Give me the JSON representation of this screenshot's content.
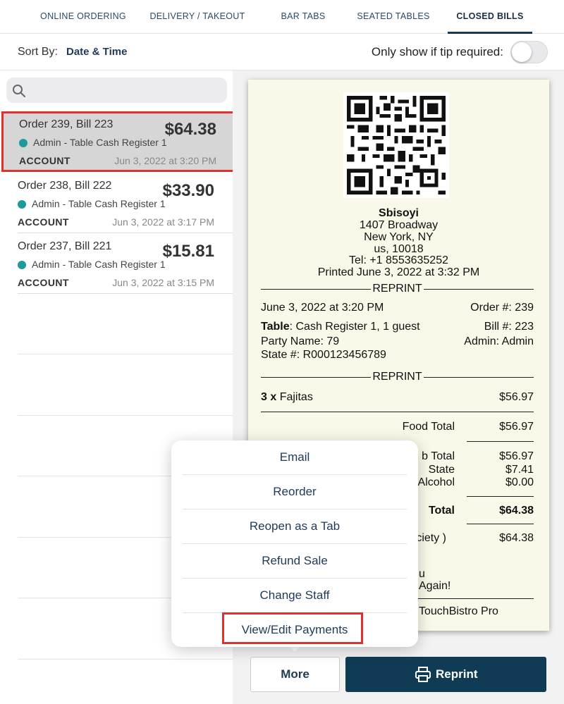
{
  "tabs": [
    {
      "label": "ONLINE ORDERING"
    },
    {
      "label": "DELIVERY / TAKEOUT"
    },
    {
      "label": "BAR TABS"
    },
    {
      "label": "SEATED TABLES"
    },
    {
      "label": "CLOSED BILLS"
    }
  ],
  "sort": {
    "label": "Sort By:",
    "value": "Date & Time"
  },
  "tip_filter": {
    "label": "Only show if tip required:"
  },
  "search": {
    "placeholder": ""
  },
  "bills": [
    {
      "title": "Order 239, Bill 223",
      "amount": "$64.38",
      "staff": "Admin - Table Cash Register 1",
      "account": "ACCOUNT",
      "time": "Jun 3, 2022 at 3:20 PM"
    },
    {
      "title": "Order 238, Bill 222",
      "amount": "$33.90",
      "staff": "Admin - Table Cash Register 1",
      "account": "ACCOUNT",
      "time": "Jun 3, 2022 at 3:17 PM"
    },
    {
      "title": "Order 237, Bill 221",
      "amount": "$15.81",
      "staff": "Admin - Table Cash Register 1",
      "account": "ACCOUNT",
      "time": "Jun 3, 2022 at 3:15 PM"
    }
  ],
  "receipt": {
    "name": "Sbisoyi",
    "address1": "1407 Broadway",
    "address2": "New York, NY",
    "address3": "us, 10018",
    "tel": "Tel: +1 8553635252",
    "printed": "Printed June 3, 2022 at 3:32 PM",
    "reprint": "REPRINT",
    "date": "June 3, 2022 at 3:20 PM",
    "order_no": "Order #: 239",
    "table_label": "Table",
    "table_value": ": Cash Register 1, 1 guest",
    "bill_no": "Bill #: 223",
    "party": "Party Name: 79",
    "admin": "Admin: Admin",
    "state_no": "State #: R000123456789",
    "item_qty": "3 x",
    "item_name": " Fajitas",
    "item_price": "$56.97",
    "food_total_label": "Food Total",
    "food_total": "$56.97",
    "sub_total_label": "b Total",
    "sub_total": "$56.97",
    "state_label": "State",
    "state_tax": "$7.41",
    "alcohol_label": "Alcohol",
    "alcohol": "$0.00",
    "total_label": "Total",
    "total": "$64.38",
    "payment_label": "ociety )",
    "payment": "$64.38",
    "thanks1": "u",
    "thanks2": "Again!",
    "footer": "TouchBistro Pro"
  },
  "menu": {
    "items": [
      "Email",
      "Reorder",
      "Reopen as a Tab",
      "Refund Sale",
      "Change Staff",
      "View/Edit Payments"
    ]
  },
  "buttons": {
    "more": "More",
    "reprint": "Reprint"
  },
  "colors": {
    "accent": "#0f3b54",
    "highlight": "#e0312f",
    "status_dot": "#1f9a9a"
  }
}
